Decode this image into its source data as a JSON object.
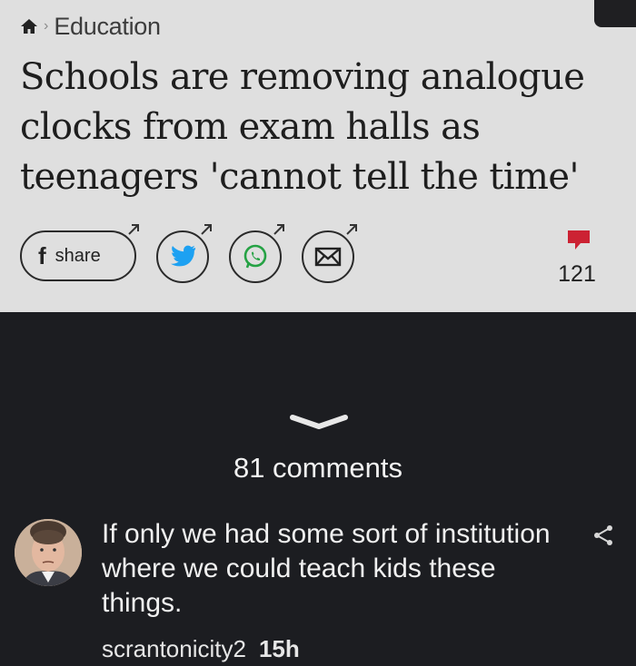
{
  "article": {
    "breadcrumb": {
      "section": "Education"
    },
    "headline": "Schools are removing analogue clocks from exam halls as teenagers 'cannot tell the time'",
    "share": {
      "facebook_glyph": "f",
      "label": "share"
    },
    "comment_count": "121",
    "icons": [
      "home-icon",
      "facebook-icon",
      "twitter-icon",
      "whatsapp-icon",
      "email-icon",
      "comment-icon",
      "external-arrow-icon"
    ]
  },
  "thread": {
    "comments_count": "81 comments",
    "comment": {
      "text": "If only we had some sort of institution where we could teach kids these things.",
      "username": "scrantonicity2",
      "time": "15h"
    }
  },
  "colors": {
    "article_bg": "#dfdfdf",
    "dark_bg": "#1c1d21",
    "comment_red": "#cc2233",
    "twitter_blue": "#1da1f2",
    "whatsapp_green": "#25a244"
  }
}
